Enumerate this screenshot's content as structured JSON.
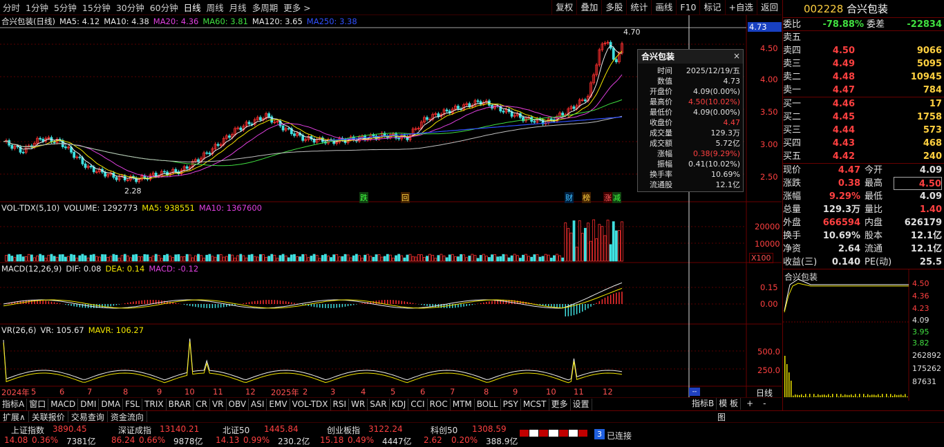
{
  "periods": [
    "分时",
    "1分钟",
    "5分钟",
    "15分钟",
    "30分钟",
    "60分钟",
    "日线",
    "周线",
    "月线",
    "多周期",
    "更多 >"
  ],
  "active_period": "日线",
  "tools": [
    "复权",
    "叠加",
    "多股",
    "统计",
    "画线",
    "F10",
    "标记",
    "+自选",
    "返回"
  ],
  "stock": {
    "code": "002228",
    "name": "合兴包装"
  },
  "main_title": {
    "name": "合兴包装(日线)",
    "ma5": "MA5: 4.12",
    "ma10": "MA10: 4.38",
    "ma20": "MA20: 4.36",
    "ma60": "MA60: 3.81",
    "ma120": "MA120: 3.65",
    "ma250": "MA250: 3.38"
  },
  "price_axis": [
    "4.50",
    "4.00",
    "3.50",
    "3.00",
    "2.50"
  ],
  "price_cursor": "4.73",
  "price_high_label": "4.70",
  "price_low_label": "2.28",
  "event_tags": [
    "跌",
    "回",
    "财",
    "榜",
    "涨",
    "减"
  ],
  "popup": {
    "title": "合兴包装",
    "close": "×",
    "rows": [
      {
        "k": "时间",
        "v": "2025/12/19/五",
        "red": false
      },
      {
        "k": "数值",
        "v": "4.73",
        "red": false
      },
      {
        "k": "开盘价",
        "v": "4.09(0.00%)",
        "red": false
      },
      {
        "k": "最高价",
        "v": "4.50(10.02%)",
        "red": true
      },
      {
        "k": "最低价",
        "v": "4.09(0.00%)",
        "red": false
      },
      {
        "k": "收盘价",
        "v": "4.47",
        "red": true
      },
      {
        "k": "成交量",
        "v": "129.3万",
        "red": false
      },
      {
        "k": "成交额",
        "v": "5.72亿",
        "red": false
      },
      {
        "k": "涨幅",
        "v": "0.38(9.29%)",
        "red": true
      },
      {
        "k": "振幅",
        "v": "0.41(10.02%)",
        "red": false
      },
      {
        "k": "换手率",
        "v": "10.69%",
        "red": false
      },
      {
        "k": "流通股",
        "v": "12.1亿",
        "red": false
      }
    ]
  },
  "vol_title": {
    "name": "VOL-TDX(5,10)",
    "volume": "VOLUME: 1292773",
    "ma5": "MA5: 938551",
    "ma10": "MA10: 1367600"
  },
  "vol_axis": [
    "20000",
    "10000"
  ],
  "vol_unit": "X100",
  "macd_title": {
    "name": "MACD(12,26,9)",
    "dif": "DIF: 0.08",
    "dea": "DEA: 0.14",
    "macd": "MACD: -0.12"
  },
  "macd_axis": [
    "0.15",
    "0.00"
  ],
  "vr_title": {
    "name": "VR(26,6)",
    "vr": "VR: 105.67",
    "mavr": "MAVR: 106.27"
  },
  "vr_axis": [
    "500.0",
    "250.0"
  ],
  "x_axis": [
    "2024年",
    "5",
    "6",
    "7",
    "8",
    "9",
    "10",
    "11",
    "12",
    "2025年",
    "2",
    "3",
    "4",
    "5",
    "6",
    "7",
    "8",
    "9",
    "10",
    "11",
    "12"
  ],
  "x_axis_mode": "日线",
  "indicator_tabs": [
    "指标A",
    "窗口",
    "MACD",
    "DMI",
    "DMA",
    "FSL",
    "TRIX",
    "BRAR",
    "CR",
    "VR",
    "OBV",
    "ASI",
    "EMV",
    "VOL-TDX",
    "RSI",
    "WR",
    "SAR",
    "KDJ",
    "CCI",
    "ROC",
    "MTM",
    "BOLL",
    "PSY",
    "MCST",
    "更多",
    "设置"
  ],
  "indicator_right": [
    "指标B",
    "模 板",
    "+",
    "-"
  ],
  "ext_tabs": [
    "扩展∧",
    "关联报价",
    "交易查询",
    "资金流向"
  ],
  "order_book": {
    "weibi_label": "委比",
    "weibi": "-78.88%",
    "weicha_label": "委差",
    "weicha": "-22834",
    "asks": [
      {
        "l": "卖五",
        "p": "",
        "v": ""
      },
      {
        "l": "卖四",
        "p": "4.50",
        "v": "9066"
      },
      {
        "l": "卖三",
        "p": "4.49",
        "v": "5095"
      },
      {
        "l": "卖二",
        "p": "4.48",
        "v": "10945"
      },
      {
        "l": "卖一",
        "p": "4.47",
        "v": "784"
      }
    ],
    "bids": [
      {
        "l": "买一",
        "p": "4.46",
        "v": "17"
      },
      {
        "l": "买二",
        "p": "4.45",
        "v": "1758"
      },
      {
        "l": "买三",
        "p": "4.44",
        "v": "573"
      },
      {
        "l": "买四",
        "p": "4.43",
        "v": "468"
      },
      {
        "l": "买五",
        "p": "4.42",
        "v": "240"
      }
    ]
  },
  "quote": [
    {
      "l1": "现价",
      "v1": "4.47",
      "l2": "今开",
      "v2": "4.09"
    },
    {
      "l1": "涨跌",
      "v1": "0.38",
      "l2": "最高",
      "v2": "4.50"
    },
    {
      "l1": "涨幅",
      "v1": "9.29%",
      "l2": "最低",
      "v2": "4.09"
    },
    {
      "l1": "总量",
      "v1": "129.3万",
      "l2": "量比",
      "v2": "1.40"
    },
    {
      "l1": "外盘",
      "v1": "666594",
      "l2": "内盘",
      "v2": "626179"
    },
    {
      "l1": "换手",
      "v1": "10.69%",
      "l2": "股本",
      "v2": "12.1亿"
    },
    {
      "l1": "净资",
      "v1": "2.64",
      "l2": "流通",
      "v2": "12.1亿"
    },
    {
      "l1": "收益(三)",
      "v1": "0.140",
      "l2": "PE(动)",
      "v2": "25.5"
    }
  ],
  "mini_chart": {
    "title": "合兴包装",
    "axis": [
      "4.50",
      "4.36",
      "4.23",
      "4.09",
      "3.95",
      "3.82"
    ],
    "vol_axis": [
      "262892",
      "175262",
      "87631"
    ]
  },
  "indices": [
    {
      "name": "上证指数",
      "value": "3890.45",
      "chg": "14.08",
      "pct": "0.36%",
      "amt": "7381亿"
    },
    {
      "name": "深证成指",
      "value": "13140.21",
      "chg": "86.24",
      "pct": "0.66%",
      "amt": "9878亿"
    },
    {
      "name": "北证50",
      "value": "1445.84",
      "chg": "14.13",
      "pct": "0.99%",
      "amt": "230.2亿"
    },
    {
      "name": "创业板指",
      "value": "3122.24",
      "chg": "15.18",
      "pct": "0.49%",
      "amt": "4447亿"
    },
    {
      "name": "科创50",
      "value": "1308.59",
      "chg": "2.62",
      "pct": "0.20%",
      "amt": "388.9亿"
    }
  ],
  "conn_count": "3",
  "conn_status": "已连接",
  "partial_right_label": "图"
}
